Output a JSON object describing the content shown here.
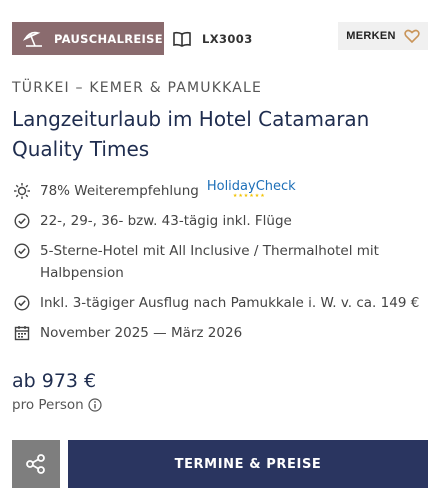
{
  "header": {
    "badge_label": "PAUSCHALREISE",
    "badge_icon": "beach-umbrella-icon",
    "code_icon": "book-icon",
    "code": "LX3003",
    "merken_label": "MERKEN",
    "merken_icon": "heart-icon"
  },
  "region": "TÜRKEI – KEMER & PAMUKKALE",
  "title": "Langzeiturlaub im Hotel Catamaran Quality Times",
  "features": [
    {
      "icon": "sun-icon",
      "text": "78% Weiterempfehlung",
      "logo": "HolidayCheck",
      "logo_stars": "★★★★★★"
    },
    {
      "icon": "check-circle-icon",
      "text": "22-, 29-, 36- bzw. 43-tägig inkl. Flüge"
    },
    {
      "icon": "check-circle-icon",
      "text": "5-Sterne-Hotel mit All Inclusive / Thermalhotel mit Halbpension"
    },
    {
      "icon": "check-circle-icon",
      "text": "Inkl. 3-tägiger Ausflug nach Pamukkale i. W. v. ca. 149 €"
    },
    {
      "icon": "calendar-icon",
      "text": "November 2025 — März 2026"
    }
  ],
  "price": {
    "amount": "ab 973 €",
    "per": "pro Person"
  },
  "actions": {
    "share_icon": "share-icon",
    "cta_label": "TERMINE & PREISE"
  },
  "colors": {
    "badge": "#8a6b6e",
    "title": "#1f2d4f",
    "cta": "#2a3560",
    "share": "#7e7e7e",
    "merken_heart": "#c9955a",
    "holidaycheck": "#1d6fb8"
  }
}
